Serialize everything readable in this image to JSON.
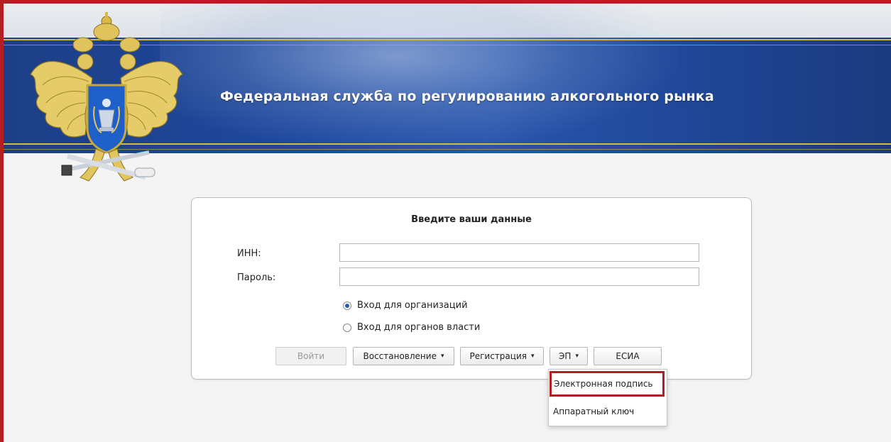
{
  "header": {
    "agency_title": "Федеральная служба по регулированию алкогольного рынка",
    "emblem_icon": "double-headed-eagle-emblem-icon"
  },
  "login": {
    "title": "Введите ваши данные",
    "inn_label": "ИНН:",
    "inn_value": "",
    "password_label": "Пароль:",
    "password_value": "",
    "radio_org": "Вход для организаций",
    "radio_gov": "Вход для органов власти",
    "selected_radio": "Вход для организаций"
  },
  "buttons": {
    "login": "Войти",
    "recovery": "Восстановление",
    "registration": "Регистрация",
    "ep": "ЭП",
    "esia": "ЕСИА",
    "caret": "▾"
  },
  "ep_menu": {
    "items": [
      "Электронная подпись",
      "Аппаратный ключ"
    ],
    "highlighted": "Электронная подпись"
  },
  "colors": {
    "banner_blue": "#1e48a0",
    "gold": "#d7b64a",
    "highlight_red": "#b21e22"
  }
}
